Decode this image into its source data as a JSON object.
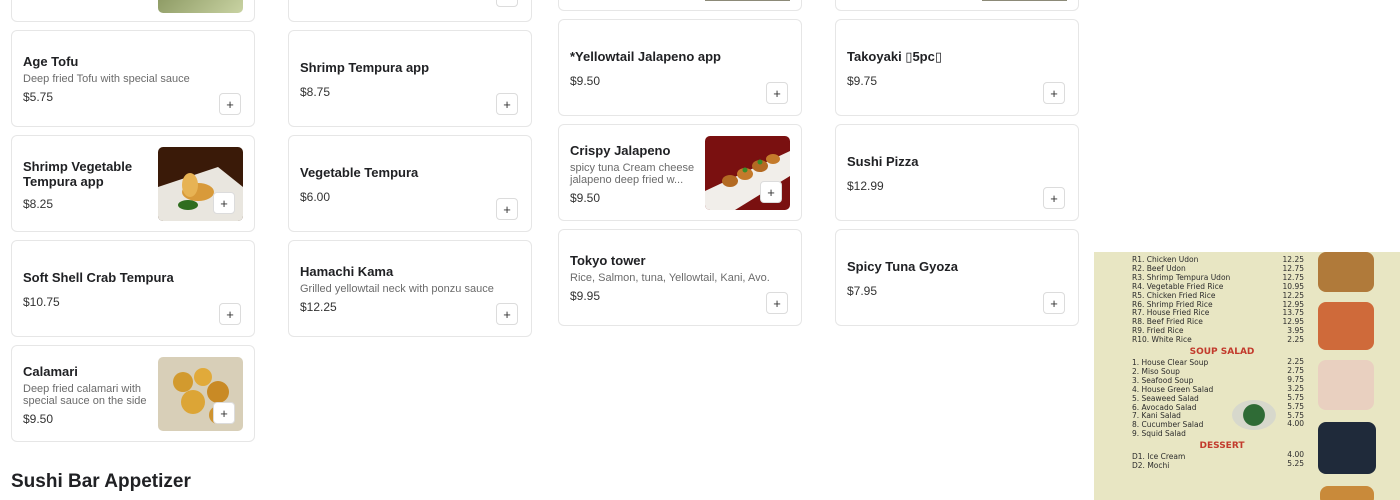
{
  "columns": [
    {
      "cards": [
        {
          "title": "Age Tofu",
          "desc": "Deep fried Tofu with special sauce",
          "price": "$5.75"
        },
        {
          "title": "Shrimp Vegetable Tempura app",
          "desc": "",
          "price": "$8.25",
          "image": "tempura-photo"
        },
        {
          "title": "Soft Shell Crab Tempura",
          "desc": "",
          "price": "$10.75"
        },
        {
          "title": "Calamari",
          "desc": "Deep fried calamari with special sauce on the side",
          "price": "$9.50",
          "image": "calamari-photo"
        }
      ]
    },
    {
      "cards": [
        {
          "title": "Shrimp Tempura app",
          "desc": "",
          "price": "$8.75"
        },
        {
          "title": "Vegetable Tempura",
          "desc": "",
          "price": "$6.00"
        },
        {
          "title": "Hamachi Kama",
          "desc": "Grilled yellowtail neck with ponzu sauce",
          "price": "$12.25"
        }
      ]
    },
    {
      "cards": [
        {
          "title": "*Yellowtail Jalapeno app",
          "desc": "",
          "price": "$9.50"
        },
        {
          "title": "Crispy Jalapeno",
          "desc": "spicy tuna Cream cheese jalapeno deep fried w...",
          "price": "$9.50",
          "image": "crispy-jalapeno-photo"
        },
        {
          "title": "Tokyo tower",
          "desc": "Rice, Salmon, tuna, Yellowtail, Kani, Avo.",
          "price": "$9.95"
        }
      ]
    },
    {
      "cards": [
        {
          "title": "Takoyaki ▯5pc▯",
          "desc": "",
          "price": "$9.75"
        },
        {
          "title": "Sushi Pizza",
          "desc": "",
          "price": "$12.99"
        },
        {
          "title": "Spicy Tuna Gyoza",
          "desc": "",
          "price": "$7.95"
        }
      ]
    }
  ],
  "add_label": "+",
  "section_heading": "Sushi Bar Appetizer",
  "menu_photo": {
    "noodle_items": [
      "R1. Chicken Udon",
      "R2. Beef Udon",
      "R3. Shrimp Tempura Udon",
      "R4. Vegetable Fried Rice",
      "R5. Chicken Fried Rice",
      "R6. Shrimp Fried Rice",
      "R7. House Fried Rice",
      "R8. Beef Fried Rice",
      "R9. Fried Rice",
      "R10. White Rice"
    ],
    "noodle_prices": [
      "12.25",
      "12.75",
      "12.75",
      "10.95",
      "12.25",
      "12.95",
      "13.75",
      "12.95",
      "3.95",
      "2.25"
    ],
    "soup_heading": "SOUP SALAD",
    "soup_items": [
      "1. House Clear Soup",
      "2. Miso Soup",
      "3. Seafood Soup",
      "4. House Green Salad",
      "5. Seaweed Salad",
      "6. Avocado Salad",
      "7. Kani Salad",
      "8. Cucumber Salad",
      "9. Squid Salad"
    ],
    "soup_prices": [
      "2.25",
      "2.75",
      "9.75",
      "3.25",
      "5.75",
      "5.75",
      "5.75",
      "4.00",
      ""
    ],
    "dessert_heading": "DESSERT",
    "dessert_items": [
      "D1. Ice Cream",
      "D2. Mochi"
    ],
    "dessert_prices": [
      "4.00",
      "5.25"
    ]
  },
  "colors": {
    "accent_red": "#c23a2c",
    "menu_bg": "#e8e6c3",
    "card_border": "#e6e6e6"
  }
}
